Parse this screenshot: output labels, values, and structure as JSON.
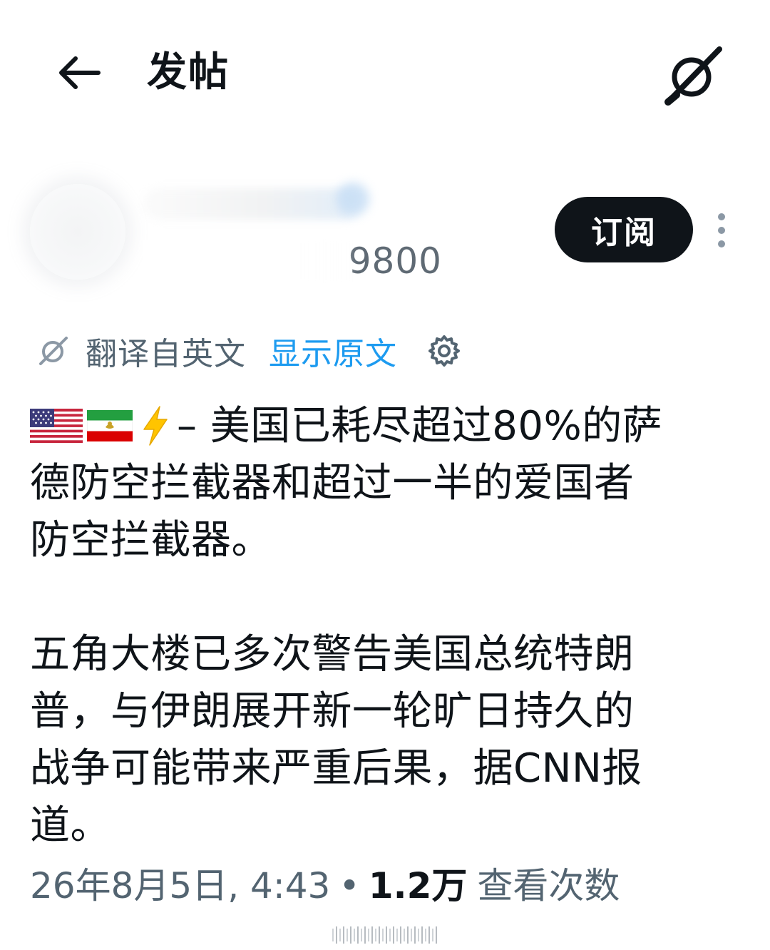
{
  "header": {
    "title": "发帖",
    "back_icon": "arrow-left-icon",
    "grok_icon": "grok-icon"
  },
  "author": {
    "handle_visible": "9800",
    "subscribe_label": "订阅",
    "more_icon": "more-vertical-icon"
  },
  "translation": {
    "label": "翻译自英文",
    "show_original": "显示原文",
    "settings_icon": "gear-icon"
  },
  "post": {
    "paragraph1_line1": "– 美国已耗尽超过80%的萨",
    "paragraph1_line2": "德防空拦截器和超过一半的爱国者",
    "paragraph1_line3": "防空拦截器。",
    "paragraph2_line1": "五角大楼已多次警告美国总统特朗",
    "paragraph2_line2": "普，与伊朗展开新一轮旷日持久的",
    "paragraph2_line3": "战争可能带来严重后果，据CNN报",
    "paragraph2_line4": "道。",
    "emojis": [
      "us-flag-icon",
      "iran-flag-icon",
      "zap-icon"
    ]
  },
  "meta": {
    "timestamp": "26年8月5日, 4:43",
    "separator": "•",
    "views_count": "1.2万",
    "views_label": "查看次数"
  },
  "colors": {
    "text_primary": "#0f1419",
    "text_secondary": "#536471",
    "link_blue": "#1d9bf0",
    "button_dark": "#0f1419"
  }
}
